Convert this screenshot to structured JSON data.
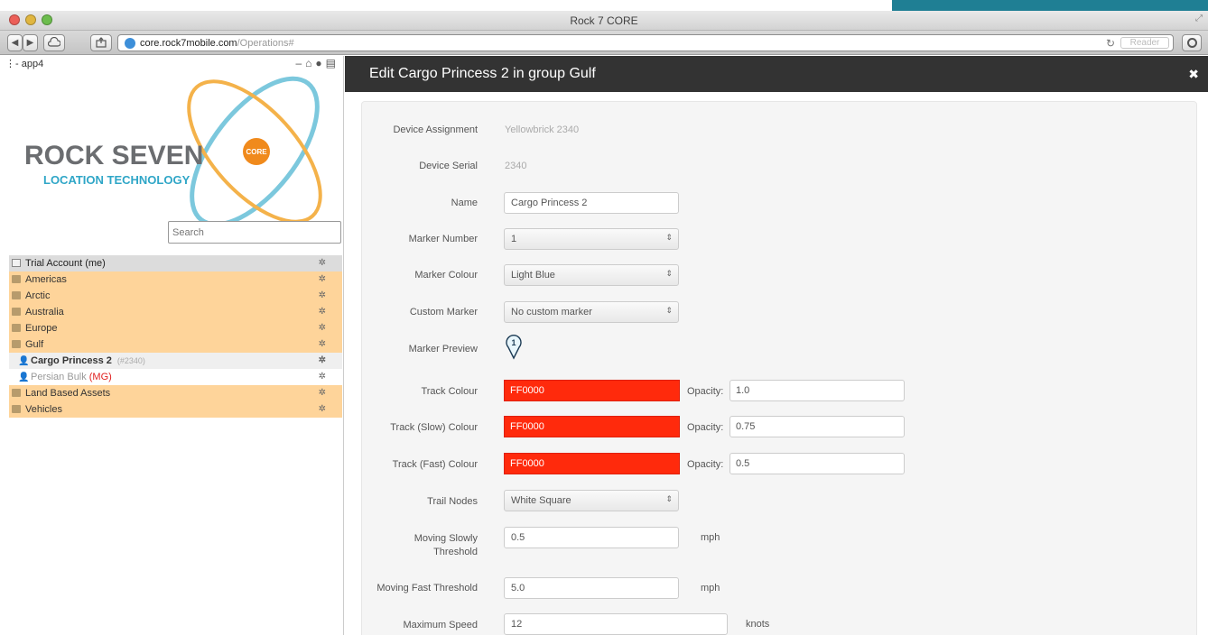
{
  "window": {
    "title": "Rock 7 CORE"
  },
  "browser": {
    "url_host": "core.rock7mobile.com",
    "url_path": "/Operations#",
    "reader_label": "Reader",
    "nav_back": "◀",
    "nav_forward": "▶"
  },
  "sidebar": {
    "app_label": "app4",
    "logo": {
      "line1": "ROCK SEVEN",
      "line2": "LOCATION TECHNOLOGY",
      "badge": "CORE"
    },
    "search_placeholder": "Search",
    "items": [
      {
        "type": "account",
        "label": "Trial Account (me)"
      },
      {
        "type": "group",
        "label": "Americas"
      },
      {
        "type": "group",
        "label": "Arctic"
      },
      {
        "type": "group",
        "label": "Australia"
      },
      {
        "type": "group",
        "label": "Europe"
      },
      {
        "type": "group",
        "label": "Gulf"
      },
      {
        "type": "device",
        "label": "Cargo Princess 2",
        "serial": "(#2340)"
      },
      {
        "type": "device",
        "label": "Persian Bulk",
        "tag": "(MG)"
      },
      {
        "type": "group",
        "label": "Land Based Assets"
      },
      {
        "type": "group",
        "label": "Vehicles"
      }
    ]
  },
  "panel": {
    "title": "Edit Cargo Princess 2 in group Gulf",
    "close_icon": "✖"
  },
  "form": {
    "device_assignment": {
      "label": "Device Assignment",
      "value": "Yellowbrick 2340"
    },
    "device_serial": {
      "label": "Device Serial",
      "value": "2340"
    },
    "name": {
      "label": "Name",
      "value": "Cargo Princess 2"
    },
    "marker_number": {
      "label": "Marker Number",
      "value": "1"
    },
    "marker_colour": {
      "label": "Marker Colour",
      "value": "Light Blue"
    },
    "custom_marker": {
      "label": "Custom Marker",
      "value": "No custom marker"
    },
    "marker_preview": {
      "label": "Marker Preview",
      "value": "1"
    },
    "track_colour": {
      "label": "Track Colour",
      "value": "FF0000",
      "opacity_label": "Opacity:",
      "opacity": "1.0"
    },
    "track_slow_colour": {
      "label": "Track (Slow) Colour",
      "value": "FF0000",
      "opacity_label": "Opacity:",
      "opacity": "0.75"
    },
    "track_fast_colour": {
      "label": "Track (Fast) Colour",
      "value": "FF0000",
      "opacity_label": "Opacity:",
      "opacity": "0.5"
    },
    "trail_nodes": {
      "label": "Trail Nodes",
      "value": "White Square"
    },
    "moving_slowly": {
      "label_line1": "Moving Slowly",
      "label_line2": "Threshold",
      "value": "0.5",
      "unit": "mph"
    },
    "moving_fast": {
      "label": "Moving Fast Threshold",
      "value": "5.0",
      "unit": "mph"
    },
    "max_speed": {
      "label": "Maximum Speed",
      "value": "12",
      "unit": "knots"
    }
  },
  "colors": {
    "accent_teal": "#1f7f94",
    "group_row": "#fed49a",
    "track_red": "#ff2a0c",
    "header_dark": "#333333"
  }
}
